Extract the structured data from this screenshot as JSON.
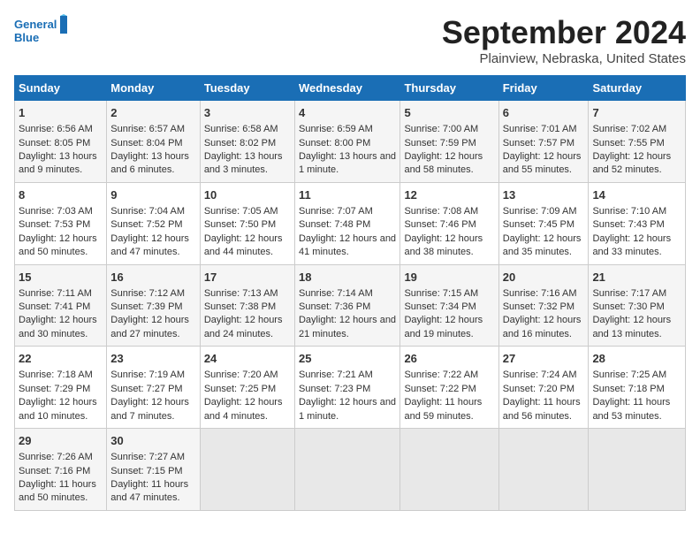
{
  "header": {
    "logo_line1": "General",
    "logo_line2": "Blue",
    "title": "September 2024",
    "subtitle": "Plainview, Nebraska, United States"
  },
  "columns": [
    "Sunday",
    "Monday",
    "Tuesday",
    "Wednesday",
    "Thursday",
    "Friday",
    "Saturday"
  ],
  "weeks": [
    [
      {
        "day": "1",
        "sunrise": "Sunrise: 6:56 AM",
        "sunset": "Sunset: 8:05 PM",
        "daylight": "Daylight: 13 hours and 9 minutes."
      },
      {
        "day": "2",
        "sunrise": "Sunrise: 6:57 AM",
        "sunset": "Sunset: 8:04 PM",
        "daylight": "Daylight: 13 hours and 6 minutes."
      },
      {
        "day": "3",
        "sunrise": "Sunrise: 6:58 AM",
        "sunset": "Sunset: 8:02 PM",
        "daylight": "Daylight: 13 hours and 3 minutes."
      },
      {
        "day": "4",
        "sunrise": "Sunrise: 6:59 AM",
        "sunset": "Sunset: 8:00 PM",
        "daylight": "Daylight: 13 hours and 1 minute."
      },
      {
        "day": "5",
        "sunrise": "Sunrise: 7:00 AM",
        "sunset": "Sunset: 7:59 PM",
        "daylight": "Daylight: 12 hours and 58 minutes."
      },
      {
        "day": "6",
        "sunrise": "Sunrise: 7:01 AM",
        "sunset": "Sunset: 7:57 PM",
        "daylight": "Daylight: 12 hours and 55 minutes."
      },
      {
        "day": "7",
        "sunrise": "Sunrise: 7:02 AM",
        "sunset": "Sunset: 7:55 PM",
        "daylight": "Daylight: 12 hours and 52 minutes."
      }
    ],
    [
      {
        "day": "8",
        "sunrise": "Sunrise: 7:03 AM",
        "sunset": "Sunset: 7:53 PM",
        "daylight": "Daylight: 12 hours and 50 minutes."
      },
      {
        "day": "9",
        "sunrise": "Sunrise: 7:04 AM",
        "sunset": "Sunset: 7:52 PM",
        "daylight": "Daylight: 12 hours and 47 minutes."
      },
      {
        "day": "10",
        "sunrise": "Sunrise: 7:05 AM",
        "sunset": "Sunset: 7:50 PM",
        "daylight": "Daylight: 12 hours and 44 minutes."
      },
      {
        "day": "11",
        "sunrise": "Sunrise: 7:07 AM",
        "sunset": "Sunset: 7:48 PM",
        "daylight": "Daylight: 12 hours and 41 minutes."
      },
      {
        "day": "12",
        "sunrise": "Sunrise: 7:08 AM",
        "sunset": "Sunset: 7:46 PM",
        "daylight": "Daylight: 12 hours and 38 minutes."
      },
      {
        "day": "13",
        "sunrise": "Sunrise: 7:09 AM",
        "sunset": "Sunset: 7:45 PM",
        "daylight": "Daylight: 12 hours and 35 minutes."
      },
      {
        "day": "14",
        "sunrise": "Sunrise: 7:10 AM",
        "sunset": "Sunset: 7:43 PM",
        "daylight": "Daylight: 12 hours and 33 minutes."
      }
    ],
    [
      {
        "day": "15",
        "sunrise": "Sunrise: 7:11 AM",
        "sunset": "Sunset: 7:41 PM",
        "daylight": "Daylight: 12 hours and 30 minutes."
      },
      {
        "day": "16",
        "sunrise": "Sunrise: 7:12 AM",
        "sunset": "Sunset: 7:39 PM",
        "daylight": "Daylight: 12 hours and 27 minutes."
      },
      {
        "day": "17",
        "sunrise": "Sunrise: 7:13 AM",
        "sunset": "Sunset: 7:38 PM",
        "daylight": "Daylight: 12 hours and 24 minutes."
      },
      {
        "day": "18",
        "sunrise": "Sunrise: 7:14 AM",
        "sunset": "Sunset: 7:36 PM",
        "daylight": "Daylight: 12 hours and 21 minutes."
      },
      {
        "day": "19",
        "sunrise": "Sunrise: 7:15 AM",
        "sunset": "Sunset: 7:34 PM",
        "daylight": "Daylight: 12 hours and 19 minutes."
      },
      {
        "day": "20",
        "sunrise": "Sunrise: 7:16 AM",
        "sunset": "Sunset: 7:32 PM",
        "daylight": "Daylight: 12 hours and 16 minutes."
      },
      {
        "day": "21",
        "sunrise": "Sunrise: 7:17 AM",
        "sunset": "Sunset: 7:30 PM",
        "daylight": "Daylight: 12 hours and 13 minutes."
      }
    ],
    [
      {
        "day": "22",
        "sunrise": "Sunrise: 7:18 AM",
        "sunset": "Sunset: 7:29 PM",
        "daylight": "Daylight: 12 hours and 10 minutes."
      },
      {
        "day": "23",
        "sunrise": "Sunrise: 7:19 AM",
        "sunset": "Sunset: 7:27 PM",
        "daylight": "Daylight: 12 hours and 7 minutes."
      },
      {
        "day": "24",
        "sunrise": "Sunrise: 7:20 AM",
        "sunset": "Sunset: 7:25 PM",
        "daylight": "Daylight: 12 hours and 4 minutes."
      },
      {
        "day": "25",
        "sunrise": "Sunrise: 7:21 AM",
        "sunset": "Sunset: 7:23 PM",
        "daylight": "Daylight: 12 hours and 1 minute."
      },
      {
        "day": "26",
        "sunrise": "Sunrise: 7:22 AM",
        "sunset": "Sunset: 7:22 PM",
        "daylight": "Daylight: 11 hours and 59 minutes."
      },
      {
        "day": "27",
        "sunrise": "Sunrise: 7:24 AM",
        "sunset": "Sunset: 7:20 PM",
        "daylight": "Daylight: 11 hours and 56 minutes."
      },
      {
        "day": "28",
        "sunrise": "Sunrise: 7:25 AM",
        "sunset": "Sunset: 7:18 PM",
        "daylight": "Daylight: 11 hours and 53 minutes."
      }
    ],
    [
      {
        "day": "29",
        "sunrise": "Sunrise: 7:26 AM",
        "sunset": "Sunset: 7:16 PM",
        "daylight": "Daylight: 11 hours and 50 minutes."
      },
      {
        "day": "30",
        "sunrise": "Sunrise: 7:27 AM",
        "sunset": "Sunset: 7:15 PM",
        "daylight": "Daylight: 11 hours and 47 minutes."
      },
      null,
      null,
      null,
      null,
      null
    ]
  ]
}
